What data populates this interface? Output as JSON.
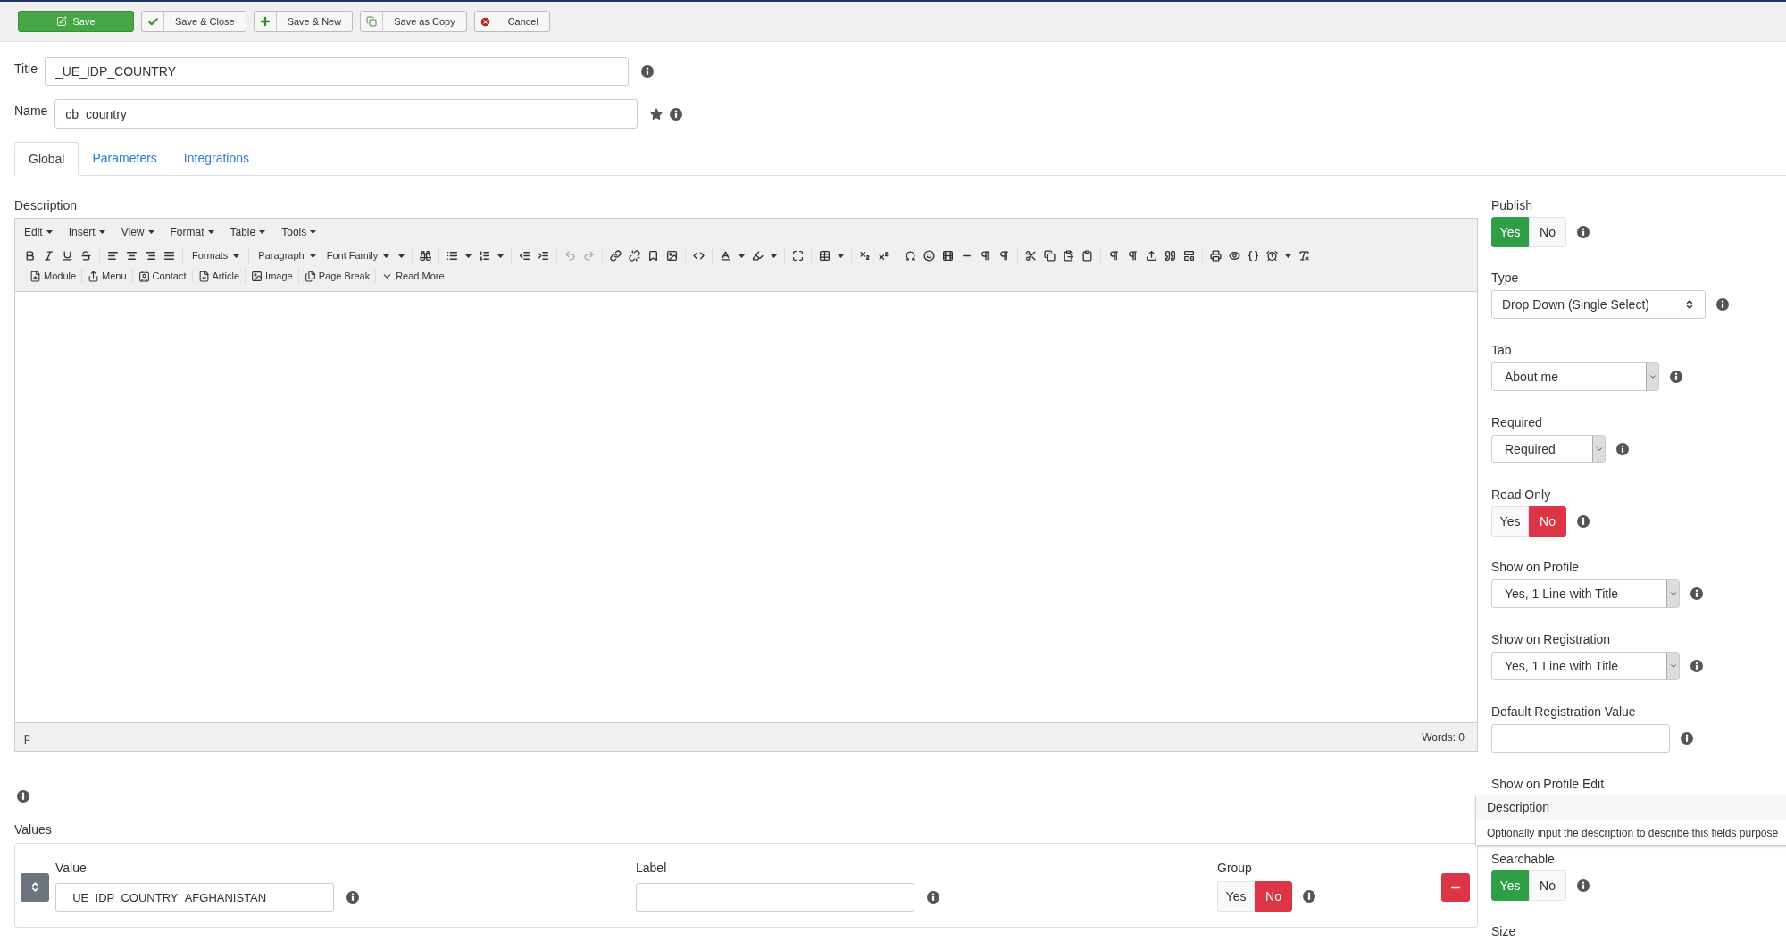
{
  "toolbar": {
    "buttons": [
      {
        "label": "Save",
        "kind": "primary"
      },
      {
        "label": "Save & Close",
        "kind": "check"
      },
      {
        "label": "Save & New",
        "kind": "plus"
      },
      {
        "label": "Save as Copy",
        "kind": "copy"
      },
      {
        "label": "Cancel",
        "kind": "cancel"
      }
    ]
  },
  "title_field": {
    "label": "Title",
    "value": "_UE_IDP_COUNTRY"
  },
  "name_field": {
    "label": "Name",
    "value": "cb_country"
  },
  "tabs": [
    {
      "label": "Global",
      "selected": true
    },
    {
      "label": "Parameters",
      "selected": false
    },
    {
      "label": "Integrations",
      "selected": false
    }
  ],
  "description": {
    "label": "Description",
    "editor": {
      "menus": [
        "Edit",
        "Insert",
        "View",
        "Format",
        "Table",
        "Tools"
      ],
      "dropdowns": [
        "Formats",
        "Paragraph",
        "Font Family"
      ],
      "insert_buttons": [
        "Module",
        "Menu",
        "Contact",
        "Article",
        "Image",
        "Page Break",
        "Read More"
      ],
      "path": "p",
      "word_count": "Words: 0"
    }
  },
  "values": {
    "label": "Values",
    "rows": [
      {
        "value_label": "Value",
        "value": "_UE_IDP_COUNTRY_AFGHANISTAN",
        "label_label": "Label",
        "group_label": "Group",
        "group_options": [
          {
            "label": "Yes",
            "selected": false
          },
          {
            "label": "No",
            "selected": true
          }
        ]
      }
    ]
  },
  "settings": [
    {
      "kind": "toggle",
      "label": "Publish",
      "options": [
        {
          "label": "Yes",
          "selected": true
        },
        {
          "label": "No",
          "selected": false
        }
      ]
    },
    {
      "kind": "native_select",
      "label": "Type",
      "value": "Drop Down (Single Select)"
    },
    {
      "kind": "select",
      "label": "Tab",
      "value": "About me"
    },
    {
      "kind": "select",
      "label": "Required",
      "value": "Required"
    },
    {
      "kind": "toggle",
      "label": "Read Only",
      "options": [
        {
          "label": "Yes",
          "selected": false
        },
        {
          "label": "No",
          "selected": true
        }
      ]
    },
    {
      "kind": "select",
      "label": "Show on Profile",
      "value": "Yes, 1 Line with Title"
    },
    {
      "kind": "select",
      "label": "Show on Registration",
      "value": "Yes, 1 Line with Title"
    },
    {
      "kind": "text",
      "label": "Default Registration Value"
    },
    {
      "kind": "covered",
      "label": "Show on Profile Edit"
    },
    {
      "kind": "toggle",
      "label": "Searchable",
      "options": [
        {
          "label": "Yes",
          "selected": true
        },
        {
          "label": "No",
          "selected": false
        }
      ]
    },
    {
      "kind": "covered",
      "label": "Size"
    }
  ],
  "tooltip": {
    "title": "Description",
    "text": "Optionally input the description to describe this fields purpose"
  }
}
